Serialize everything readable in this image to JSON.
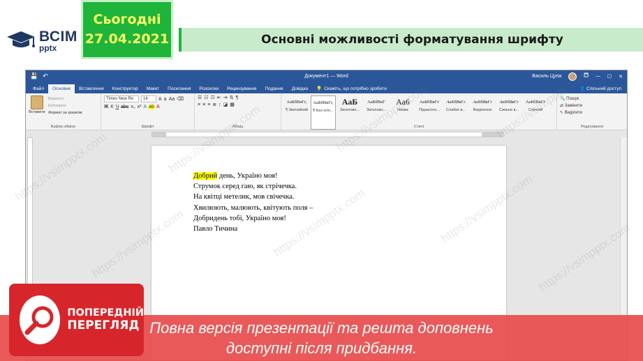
{
  "slide": {
    "logo": {
      "big": "ВСІМ",
      "small": "pptx"
    },
    "date_title": "Сьогодні",
    "date": "27.04.2021",
    "title": "Основні можливості форматування шрифту",
    "colors": {
      "accent_green": "#1eb53a",
      "title_bg": "#c8eccb",
      "date_text": "#ffff66"
    }
  },
  "watermark": "https://vsimpptx.com",
  "word": {
    "quick_access": [
      "💾",
      "↶"
    ],
    "window_title": "Документ1 — Word",
    "user_name": "Василь Цупа",
    "window_controls": [
      "🗖",
      "—",
      "☐",
      "✕"
    ],
    "tabs": [
      "Файл",
      "Основне",
      "Вставлення",
      "Конструктор",
      "Макет",
      "Посилання",
      "Розсилки",
      "Рецензування",
      "Подання",
      "Довідка"
    ],
    "tell_me": "Скажіть, що потрібно зробити",
    "share": "Спільний доступ",
    "ribbon": {
      "clipboard": {
        "paste": "Вставити",
        "cut": "Вирізати",
        "copy": "Копіювати",
        "format_painter": "Формат за зразком",
        "label": "Буфер обміну"
      },
      "font": {
        "name": "Times New Ro",
        "size": "14",
        "label": "Шрифт"
      },
      "paragraph": {
        "label": "Абзац"
      },
      "styles": {
        "items": [
          {
            "preview": "АаБбВвГг,",
            "name": "¶ Звичайний"
          },
          {
            "preview": "АаБбВвГг,",
            "name": "¶ Без інте..."
          },
          {
            "preview": "АаБ",
            "name": "Заголово..."
          },
          {
            "preview": "АаБбВвГ",
            "name": "Заголово..."
          },
          {
            "preview": "Аа6",
            "name": "Назва"
          },
          {
            "preview": "АаБбВвГг",
            "name": "Підзаголо..."
          },
          {
            "preview": "АаБбВвГг",
            "name": "Слабке в..."
          },
          {
            "preview": "АаБбВвГг",
            "name": "Виділення"
          },
          {
            "preview": "АаБбВвГг",
            "name": "Сильне в..."
          },
          {
            "preview": "АаБбВвГг",
            "name": "Строгий"
          }
        ],
        "label": "Стилі"
      },
      "editing": {
        "find": "Пошук",
        "replace": "Замінити",
        "select": "Виділити",
        "label": "Редагування"
      }
    },
    "document": {
      "highlighted_word": "Добрий",
      "first_line_rest": " день, Україно моя!",
      "lines": [
        "Струмок серед гаю, як стрічечка.",
        "На квітці метелик, мов свічечка.",
        "Хвилюють, малюють, квітують поля –",
        "Добридень тобі, Україно моя!",
        "Павло Тичина"
      ]
    },
    "colors": {
      "title_bar": "#2b579a",
      "highlight": "#ffff00"
    }
  },
  "preview": {
    "badge_line1": "ПОПЕРЕДНІЙ",
    "badge_line2": "ПЕРЕГЛЯД",
    "banner_line1": "Повна версія презентації та решта доповнень",
    "banner_line2": "доступні після придбання.",
    "colors": {
      "banner": "#e84c4c",
      "badge": "#d7262b"
    }
  }
}
